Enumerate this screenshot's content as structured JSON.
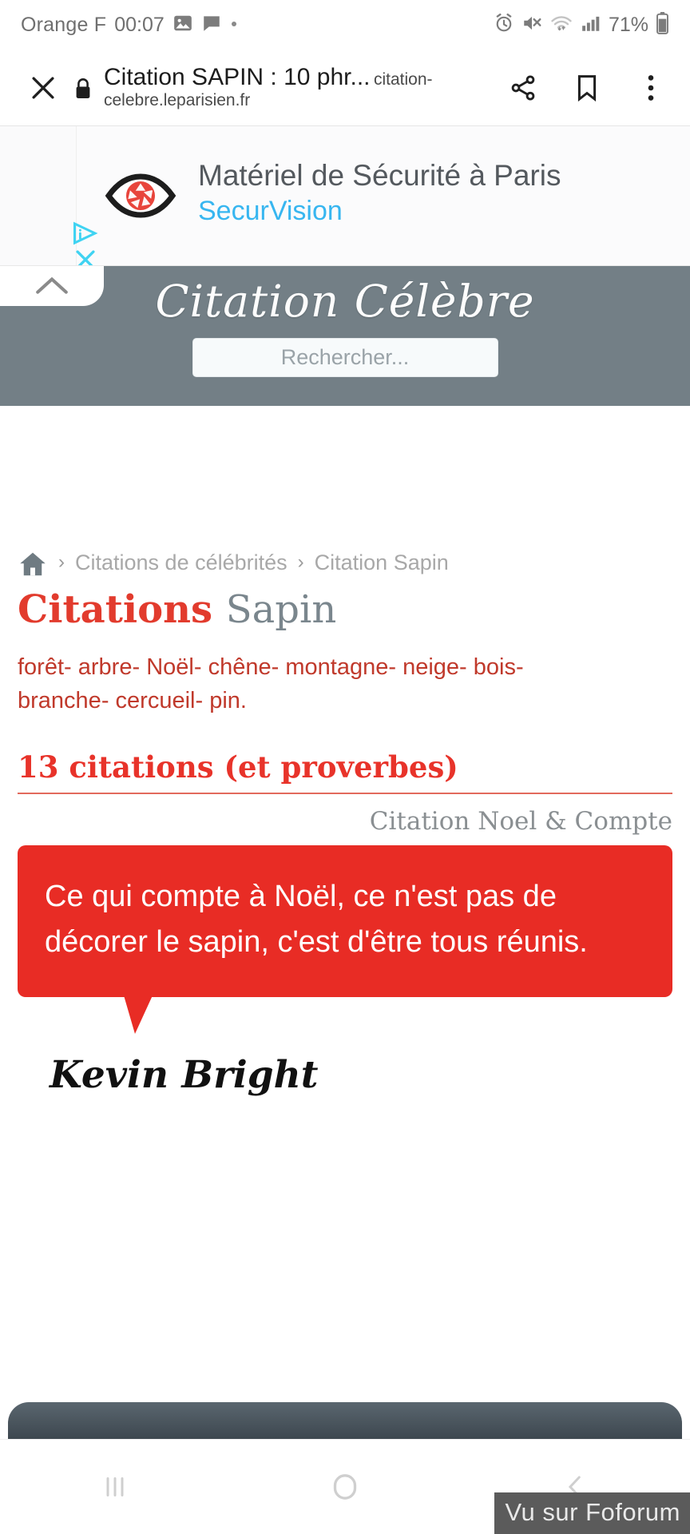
{
  "status_bar": {
    "carrier": "Orange F",
    "time": "00:07",
    "battery": "71%",
    "icons_left": [
      "image-icon",
      "message-icon",
      "dot-icon"
    ],
    "icons_right": [
      "alarm-icon",
      "mute-icon",
      "wifi-icon",
      "signal-icon",
      "battery-icon"
    ]
  },
  "browser": {
    "close_label": "✕",
    "security": "lock-icon",
    "title": "Citation SAPIN : 10 phr...",
    "url": "citation-celebre.leparisien.fr",
    "actions": [
      "share-icon",
      "bookmark-icon",
      "overflow-menu-icon"
    ]
  },
  "ad": {
    "headline": "Matériel de Sécurité à Paris",
    "brand": "SecurVision",
    "adchoices_label": "AdChoices",
    "close_label": "✕",
    "logo": "eye-aperture-icon",
    "brand_color": "#37b6f0",
    "logo_color": "#e8453c"
  },
  "site_header": {
    "brand": "Citation Célèbre",
    "collapse_icon": "chevron-up-icon",
    "search_placeholder": "Rechercher...",
    "bg_color": "#737f86"
  },
  "breadcrumb": {
    "home_icon": "home-icon",
    "separator": "›",
    "items": [
      {
        "label": "Citations de célébrités"
      },
      {
        "label": "Citation Sapin"
      }
    ]
  },
  "page": {
    "title_primary": "Citations",
    "title_secondary": "Sapin",
    "tags": [
      "forêt",
      "arbre",
      "Noël",
      "chêne",
      "montagne",
      "neige",
      "bois",
      "branche",
      "cercueil",
      "pin"
    ],
    "tag_separator": "-",
    "tags_end": ".",
    "count_heading": "13 citations (et proverbes)",
    "accent_red": "#e8332a",
    "accent_grey": "#7a868d"
  },
  "quote_card": {
    "category_label": "Citation Noel & Compte",
    "text": "Ce qui compte à Noël, ce n'est pas de décorer le sapin, c'est d'être tous réunis.",
    "author": "Kevin Bright",
    "bubble_color": "#e82c25"
  },
  "system_nav": {
    "recents_icon": "recents-icon",
    "home_icon": "home-circle-icon",
    "back_icon": "back-chevron-icon"
  },
  "watermark": {
    "text": "Vu sur Foforum"
  }
}
